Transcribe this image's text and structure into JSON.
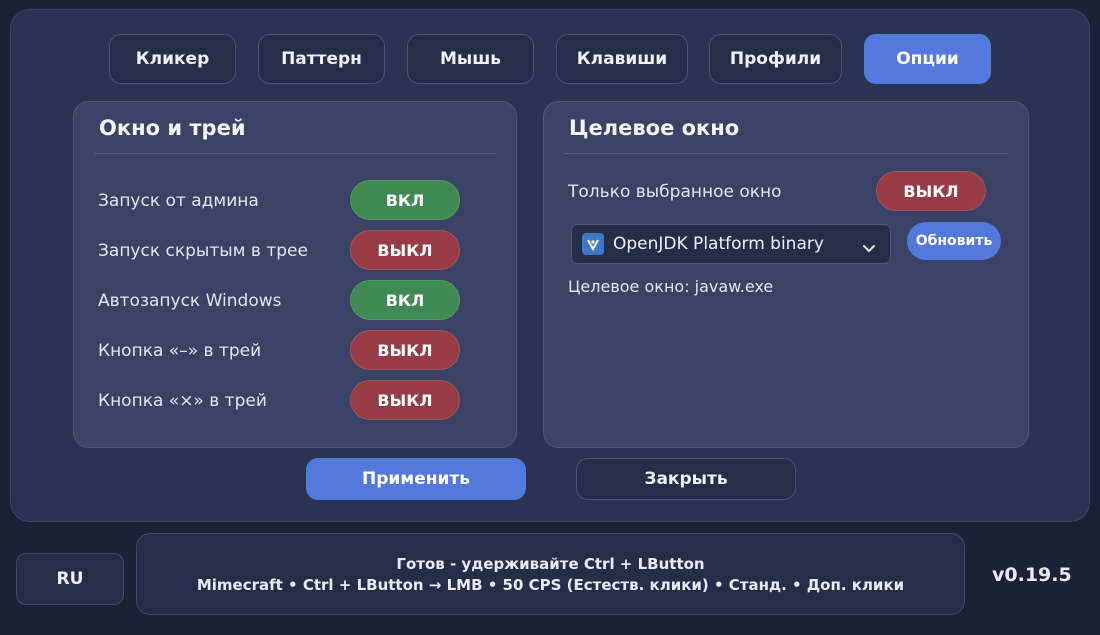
{
  "tabs": [
    {
      "label": "Кликер"
    },
    {
      "label": "Паттерн"
    },
    {
      "label": "Мышь"
    },
    {
      "label": "Клавиши"
    },
    {
      "label": "Профили"
    },
    {
      "label": "Опции",
      "active": true
    }
  ],
  "window_tray": {
    "title": "Окно и трей",
    "rows": [
      {
        "label": "Запуск от админа",
        "state": "ВКЛ"
      },
      {
        "label": "Запуск скрытым в трее",
        "state": "ВЫКЛ"
      },
      {
        "label": "Автозапуск Windows",
        "state": "ВКЛ"
      },
      {
        "label": "Кнопка «–» в трей",
        "state": "ВЫКЛ"
      },
      {
        "label": "Кнопка «×» в трей",
        "state": "ВЫКЛ"
      }
    ]
  },
  "target_window": {
    "title": "Целевое окно",
    "only_selected_label": "Только выбранное окно",
    "only_selected_state": "ВЫКЛ",
    "selected_process": "OpenJDK Platform binary",
    "refresh_label": "Обновить",
    "target_text": "Целевое окно: javaw.exe"
  },
  "actions": {
    "apply_label": "Применить",
    "close_label": "Закрыть"
  },
  "footer": {
    "language": "RU",
    "status_line1": "Готов - удерживайте Ctrl + LButton",
    "status_line2": "Mimecraft  •  Ctrl + LButton → LMB  •  50 CPS (Естеств. клики)  •  Станд.  •  Доп. клики",
    "version": "v0.19.5"
  },
  "colors": {
    "accent": "#5479dd",
    "on": "#3e8a52",
    "off": "#973c44",
    "panel": "#2b3352",
    "card": "#3a4266",
    "background": "#1c2236"
  }
}
